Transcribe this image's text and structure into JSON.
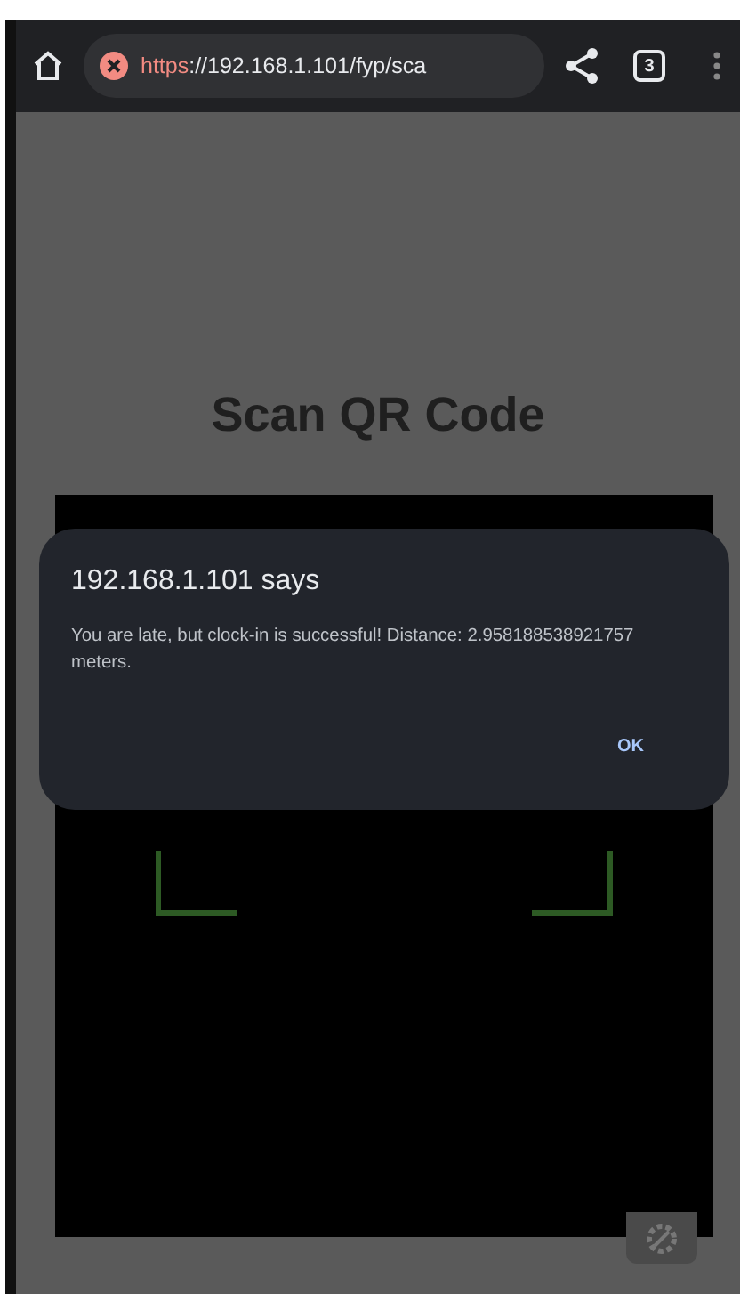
{
  "browser": {
    "url": "https://192.168.1.101/fyp/sca",
    "tab_count": "3",
    "insecure": true
  },
  "page": {
    "title": "Scan QR Code"
  },
  "dialog": {
    "title": "192.168.1.101 says",
    "message": "You are late, but clock-in is successful! Distance: 2.958188538921757 meters.",
    "button": "OK"
  }
}
